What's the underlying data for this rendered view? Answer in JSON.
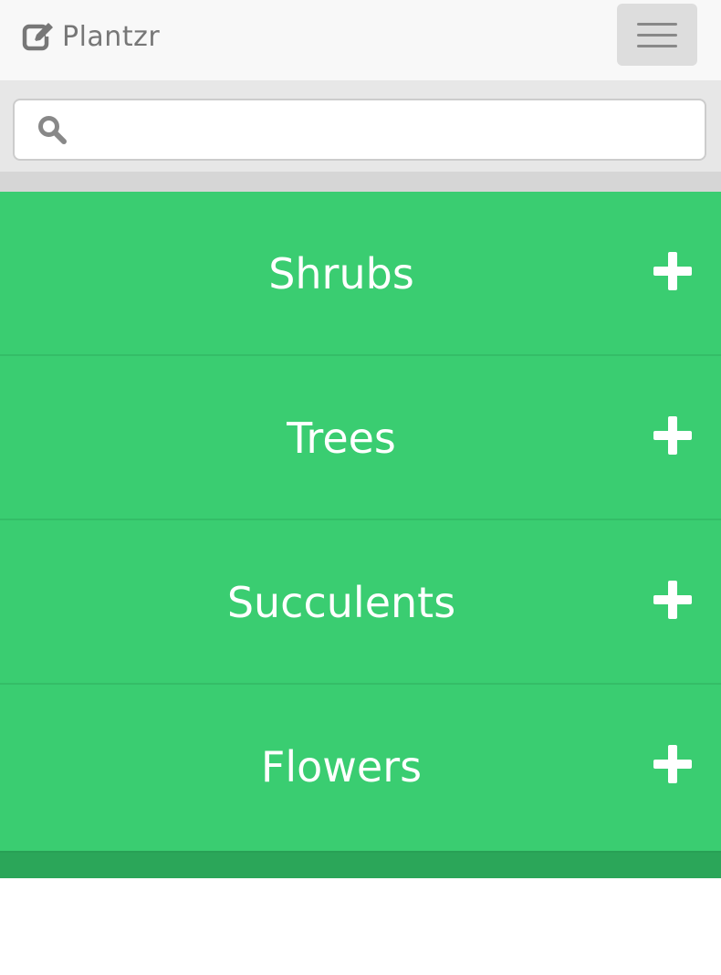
{
  "app": {
    "brand_name": "Plantzr",
    "brand_icon": "edit-square-icon",
    "menu_icon": "hamburger-menu-icon"
  },
  "search": {
    "placeholder": "",
    "value": "",
    "icon": "search-icon"
  },
  "categories": {
    "items": [
      {
        "label": "Shrubs",
        "icon": "plus-icon"
      },
      {
        "label": "Trees",
        "icon": "plus-icon"
      },
      {
        "label": "Succulents",
        "icon": "plus-icon"
      },
      {
        "label": "Flowers",
        "icon": "plus-icon"
      }
    ]
  },
  "colors": {
    "navbar_bg": "#f8f8f8",
    "brand_text": "#777777",
    "toggle_bg": "#dddddd",
    "search_band_bg": "#e7e7e7",
    "category_bg": "#3acd71",
    "footer_bg": "#2ba659",
    "category_text": "#ffffff"
  }
}
